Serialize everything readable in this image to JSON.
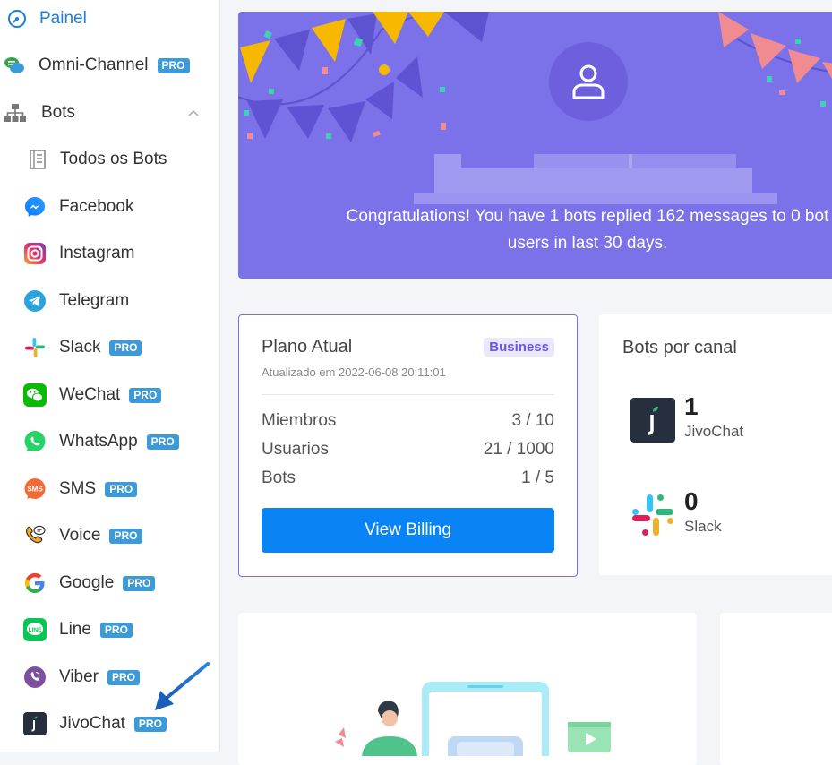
{
  "sidebar": {
    "items": [
      {
        "label": "Painel",
        "icon": "dashboard-icon",
        "pro": false,
        "active": true
      },
      {
        "label": "Omni-Channel",
        "icon": "omnichannel-icon",
        "pro": true
      },
      {
        "label": "Bots",
        "icon": "sitemap-icon",
        "pro": false,
        "expanded": true
      },
      {
        "label": "Todos os Bots",
        "icon": "list-icon",
        "pro": false
      },
      {
        "label": "Facebook",
        "icon": "messenger-icon",
        "pro": false
      },
      {
        "label": "Instagram",
        "icon": "instagram-icon",
        "pro": false
      },
      {
        "label": "Telegram",
        "icon": "telegram-icon",
        "pro": false
      },
      {
        "label": "Slack",
        "icon": "slack-icon",
        "pro": true
      },
      {
        "label": "WeChat",
        "icon": "wechat-icon",
        "pro": true
      },
      {
        "label": "WhatsApp",
        "icon": "whatsapp-icon",
        "pro": true
      },
      {
        "label": "SMS",
        "icon": "sms-icon",
        "pro": true
      },
      {
        "label": "Voice",
        "icon": "phone-icon",
        "pro": true
      },
      {
        "label": "Google",
        "icon": "google-icon",
        "pro": true
      },
      {
        "label": "Line",
        "icon": "line-icon",
        "pro": true
      },
      {
        "label": "Viber",
        "icon": "viber-icon",
        "pro": true
      },
      {
        "label": "JivoChat",
        "icon": "jivochat-icon",
        "pro": true
      }
    ],
    "pro_label": "PRO",
    "sms_icon_text": "SMS",
    "line_icon_text": "LINE"
  },
  "banner": {
    "message": "Congratulations! You have 1 bots replied 162 messages to 0 bot users in last 30 days."
  },
  "plan": {
    "title": "Plano Atual",
    "badge": "Business",
    "updated": "Atualizado em 2022-06-08 20:11:01",
    "stats": [
      {
        "label": "Miembros",
        "value": "3 / 10"
      },
      {
        "label": "Usuarios",
        "value": "21 / 1000"
      },
      {
        "label": "Bots",
        "value": "1 / 5"
      }
    ],
    "button_label": "View Billing"
  },
  "channels": {
    "title": "Bots por canal",
    "items": [
      {
        "count": "1",
        "name": "JivoChat",
        "icon": "jivochat-icon"
      },
      {
        "count": "0",
        "name": "Slack",
        "icon": "slack-icon"
      }
    ]
  },
  "colors": {
    "accent": "#3d9ad9",
    "banner": "#7b72ea",
    "button": "#0a84f5",
    "badge_text": "#6a55e8"
  }
}
